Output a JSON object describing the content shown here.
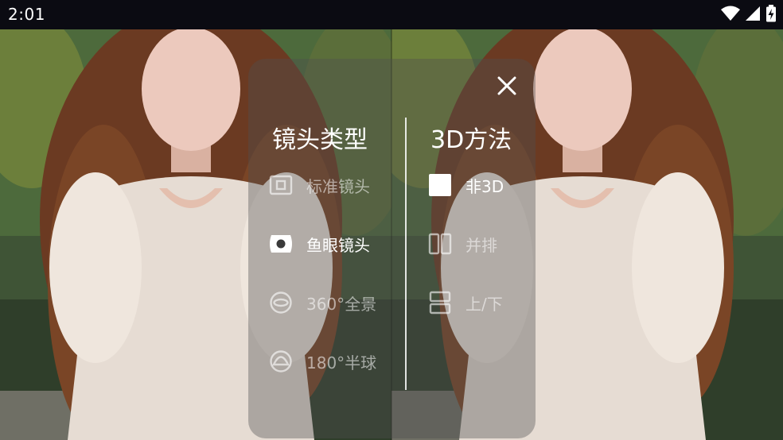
{
  "status_bar": {
    "time": "2:01"
  },
  "dialog": {
    "close_icon": "close-icon",
    "lens_column": {
      "title": "镜头类型",
      "items": [
        {
          "label": "标准镜头",
          "icon": "standard-lens-icon",
          "selected": false
        },
        {
          "label": "鱼眼镜头",
          "icon": "fisheye-lens-icon",
          "selected": true
        },
        {
          "label": "360°全景",
          "icon": "panorama-360-icon",
          "selected": false
        },
        {
          "label": "180°半球",
          "icon": "hemisphere-180-icon",
          "selected": false
        }
      ]
    },
    "mode_column": {
      "title": "3D方法",
      "items": [
        {
          "label": "非3D",
          "icon": "non-3d-icon",
          "selected": true
        },
        {
          "label": "并排",
          "icon": "side-by-side-icon",
          "selected": false
        },
        {
          "label": "上/下",
          "icon": "top-bottom-icon",
          "selected": false
        }
      ]
    }
  }
}
